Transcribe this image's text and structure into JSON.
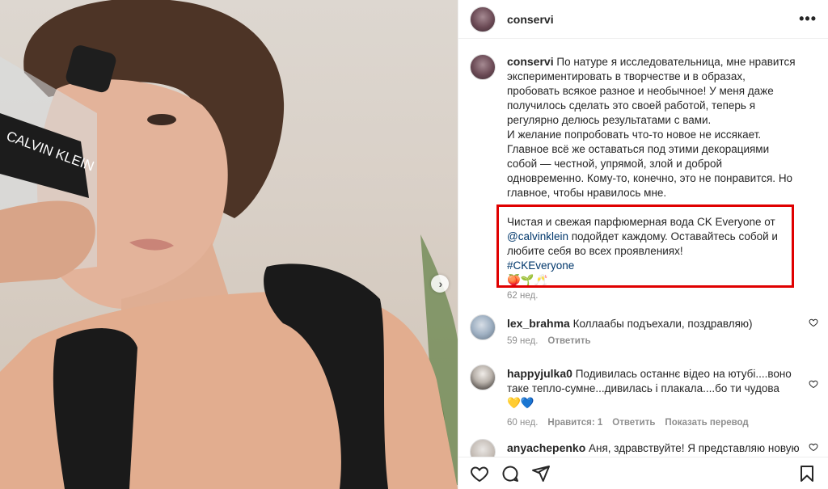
{
  "post": {
    "username": "conservi",
    "more_icon": "more-horizontal-icon"
  },
  "photo": {
    "bottle_text": "CALVIN KLEIN",
    "next_icon": "chevron-right-icon"
  },
  "caption": {
    "username": "conservi",
    "text_main": "По натуре я исследовательница, мне нравится экспериментировать в творчестве и в образах, пробовать всякое разное и необычное! У меня даже получилось сделать это своей работой, теперь я регулярно делюсь результатами с вами.",
    "text_second": "И желание попробовать что-то новое не иссякает. Главное всё же оставаться под этими декорациями собой — честной, упрямой, злой и доброй одновременно. Кому-то, конечно, это не понравится. Но главное, чтобы нравилось мне.",
    "promo_prefix": "Чистая и свежая парфюмерная вода CK Everyone от ",
    "promo_mention": "@calvinklein",
    "promo_suffix": " подойдет каждому. Оставайтесь собой и любите себя во всех проявлениях!",
    "hashtag": "#CKEveryone",
    "emoji": "🍑🌱🥂",
    "time": "62 нед."
  },
  "comments": [
    {
      "username": "lex_brahma",
      "text": "Коллаабы подъехали, поздравляю)",
      "time": "59 нед.",
      "reply": "Ответить"
    },
    {
      "username": "happyjulka0",
      "text": "Подивилась останнє відео на ютубі....воно таке тепло-сумне...дивилась і плакала....бо ти чудова 💛💙",
      "time": "60 нед.",
      "likes": "Нравится: 1",
      "reply": "Ответить",
      "translate": "Показать перевод"
    },
    {
      "username": "anyachepenko",
      "text": "Аня, здравствуйте! Я представляю новую"
    }
  ],
  "action_bar": {
    "icons": [
      "heart-icon",
      "comment-icon",
      "share-icon",
      "bookmark-icon"
    ]
  },
  "colors": {
    "highlight": "#e00000",
    "link": "#00376b",
    "muted": "#8e8e8e"
  }
}
